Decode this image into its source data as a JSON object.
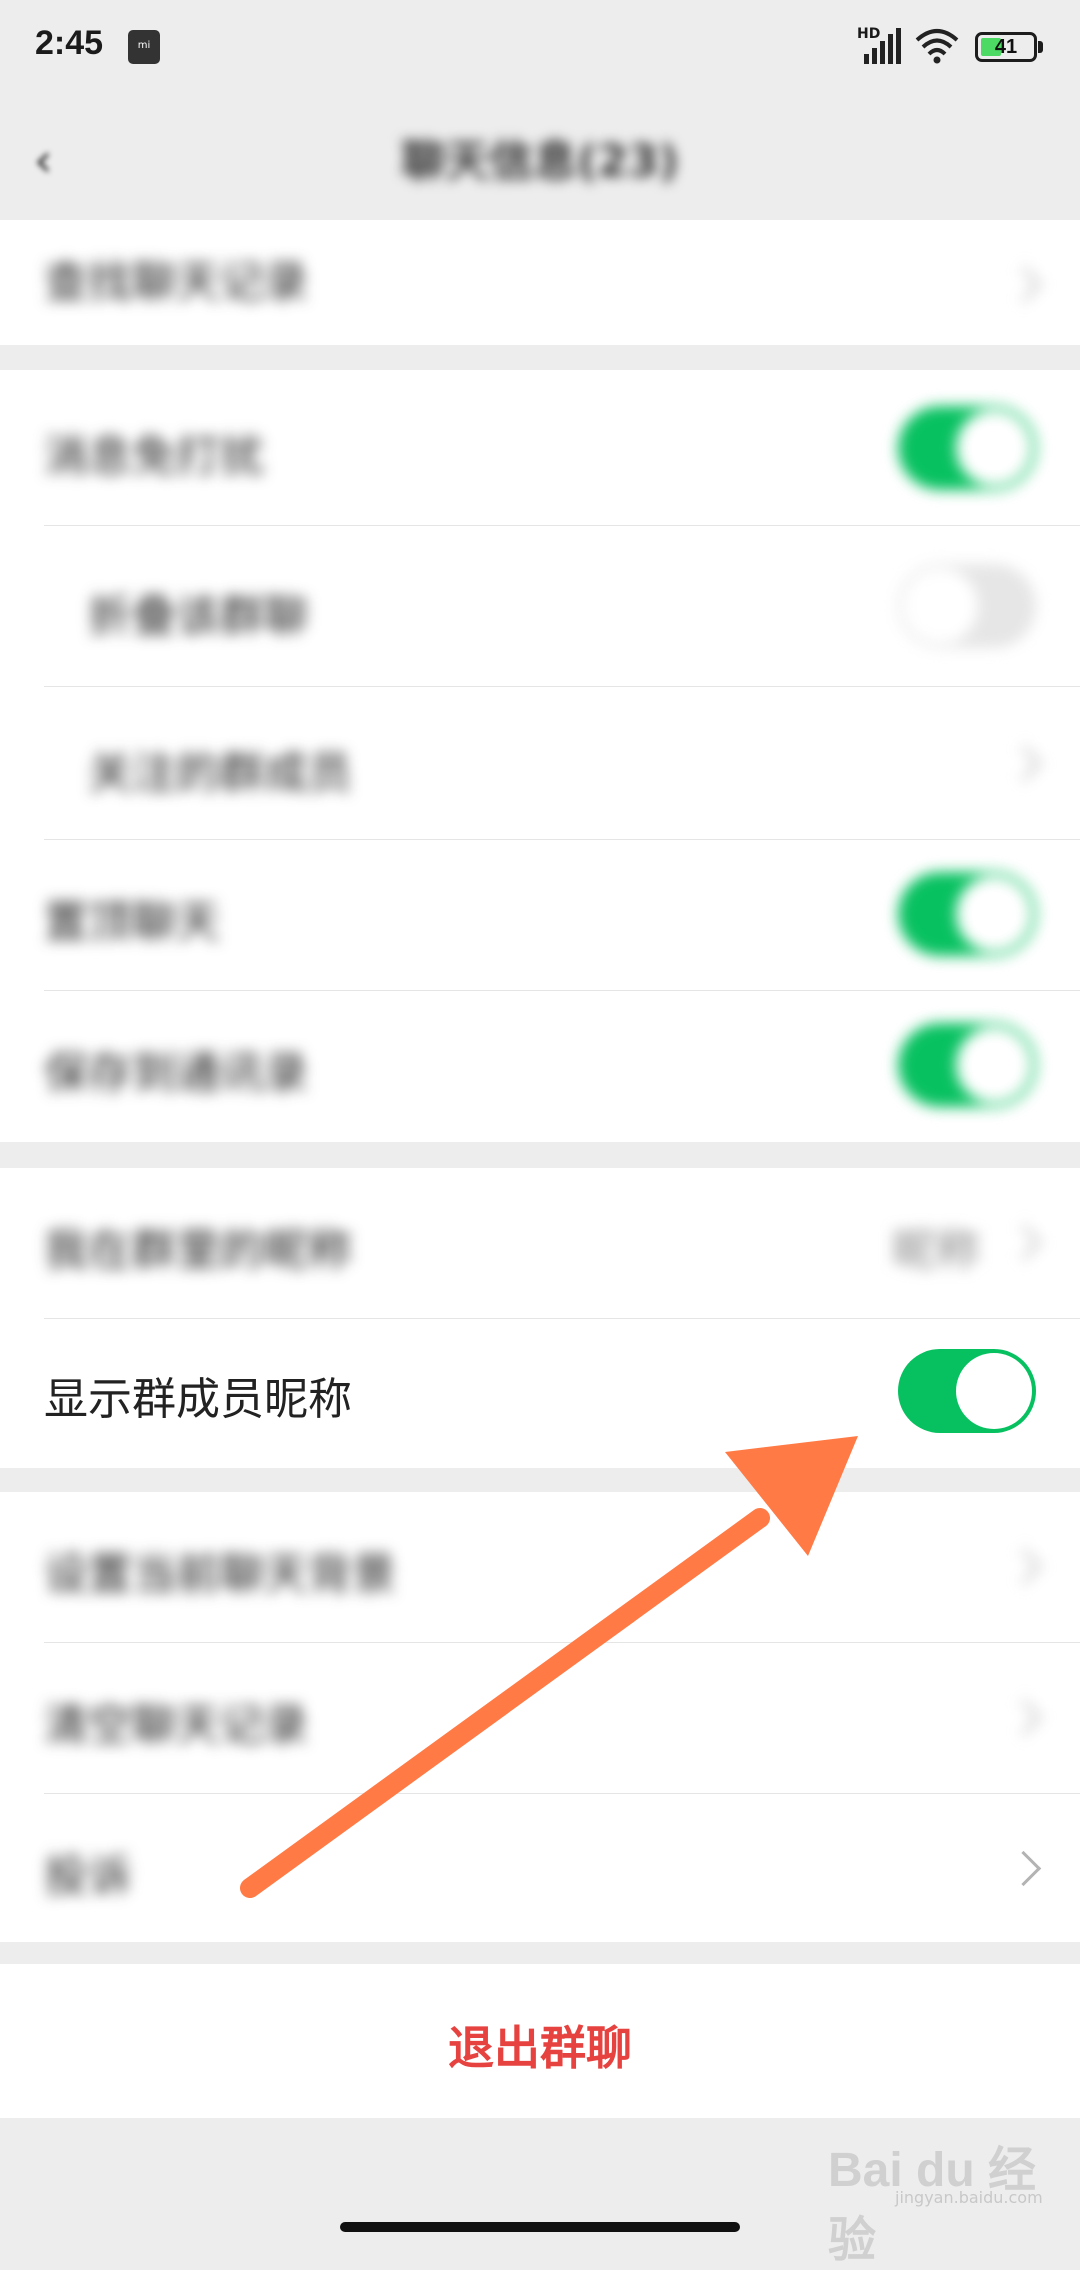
{
  "status_bar": {
    "time": "2:45",
    "app_badge": "mi",
    "network": "HD",
    "battery": "41"
  },
  "nav": {
    "title": "聊天信息(23)",
    "back_icon": "back-arrow-icon"
  },
  "rows": {
    "search_history": "查找聊天记录",
    "mute": "消息免打扰",
    "fold_group": "折叠该群聊",
    "followed_members": "关注的群成员",
    "pin_chat": "置顶聊天",
    "save_contacts": "保存到通讯录",
    "my_nickname": "我在群里的昵称",
    "my_nickname_value": "昵称",
    "show_member_nicknames": "显示群成员昵称",
    "set_background": "设置当前聊天背景",
    "clear_history": "清空聊天记录",
    "report": "投诉"
  },
  "toggles": {
    "mute": true,
    "fold_group": false,
    "pin_chat": true,
    "save_contacts": true,
    "show_member_nicknames": true
  },
  "exit_label": "退出群聊",
  "watermark": {
    "brand": "Bai du 经验",
    "url": "jingyan.baidu.com"
  },
  "colors": {
    "accent_green": "#07c160",
    "danger_red": "#e64340",
    "arrow_orange": "#ff7a45"
  }
}
